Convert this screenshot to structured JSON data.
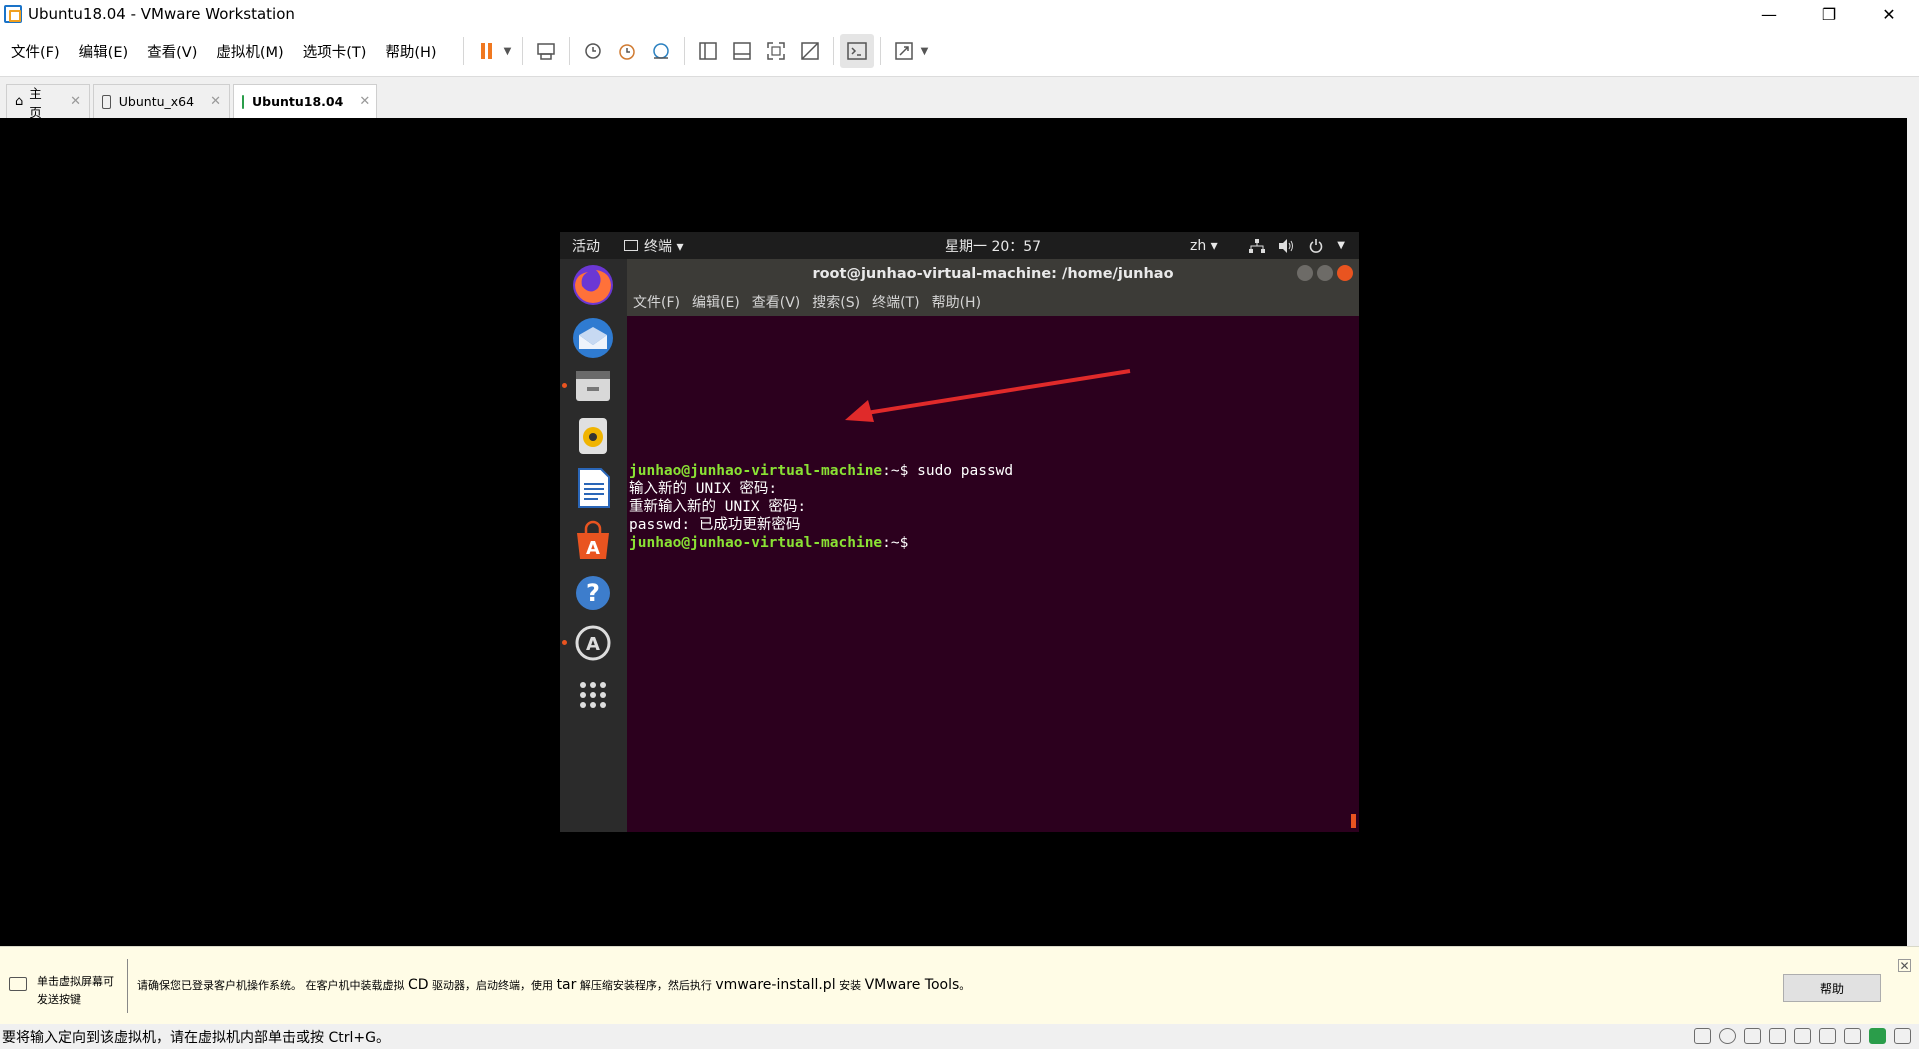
{
  "window": {
    "title": "Ubuntu18.04 - VMware Workstation",
    "controls": {
      "minimize": "—",
      "restore": "❐",
      "close": "✕"
    }
  },
  "menubar": {
    "items": [
      "文件(F)",
      "编辑(E)",
      "查看(V)",
      "虚拟机(M)",
      "选项卡(T)",
      "帮助(H)"
    ]
  },
  "tabs": [
    {
      "label": "主页",
      "close": "✕"
    },
    {
      "label": "Ubuntu_x64",
      "close": "✕"
    },
    {
      "label": "Ubuntu18.04",
      "close": "✕"
    }
  ],
  "ubuntu": {
    "topbar": {
      "activities": "活动",
      "app_menu": "终端 ▾",
      "clock": "星期一 20：57",
      "lang": "zh ▾"
    },
    "terminal": {
      "title": "root@junhao-virtual-machine: /home/junhao",
      "menu": [
        "文件(F)",
        "编辑(E)",
        "查看(V)",
        "搜索(S)",
        "终端(T)",
        "帮助(H)"
      ],
      "lines": [
        {
          "prompt": "junhao@junhao-virtual-machine",
          "path": ":~$",
          "cmd": " sudo passwd"
        },
        {
          "text": "输入新的 UNIX 密码:"
        },
        {
          "text": "重新输入新的 UNIX 密码:"
        },
        {
          "text": "passwd: 已成功更新密码"
        },
        {
          "prompt": "junhao@junhao-virtual-machine",
          "path": ":~$",
          "cmd": ""
        }
      ]
    },
    "dock": [
      "firefox",
      "thunderbird",
      "files",
      "rhythmbox",
      "libreoffice-writer",
      "ubuntu-software",
      "help",
      "software-updater",
      "show-applications"
    ]
  },
  "infobar": {
    "hint_line1": "单击虚拟屏幕可",
    "hint_line2": "发送按键",
    "message_pre": "请确保您已登录客户机操作系统。 在客户机中装载虚拟 ",
    "message_cd": "CD",
    "message_mid1": " 驱动器，启动终端，使用 ",
    "message_tar": "tar",
    "message_mid2": " 解压缩安装程序，然后执行 ",
    "message_script": "vmware-install.pl",
    "message_mid3": " 安装 ",
    "message_tools": "VMware Tools",
    "message_end": "。",
    "help_button": "帮助",
    "close": "✕"
  },
  "statusbar": {
    "text": "要将输入定向到该虚拟机，请在虚拟机内部单击或按 Ctrl+G。"
  },
  "colors": {
    "accent": "#e95420",
    "terminal_bg": "#2c001e",
    "prompt": "#8ae234",
    "pause_orange": "#f07820"
  }
}
